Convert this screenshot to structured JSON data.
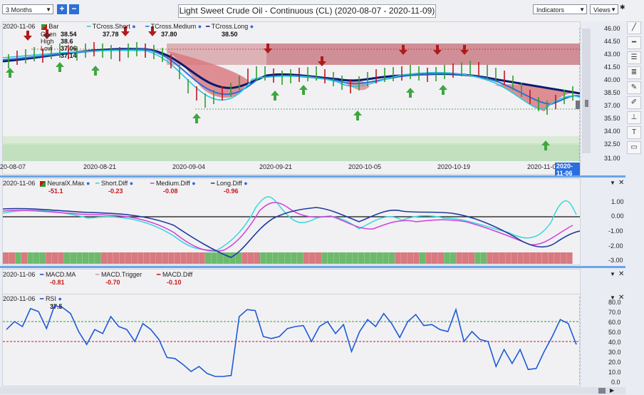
{
  "toolbar": {
    "range_value": "3 Months",
    "add_label": "+",
    "remove_label": "−",
    "title": "Light Sweet Crude Oil - Continuous (CL) (2020-08-07 - 2020-11-09)",
    "indicators_label": "Indicators",
    "views_label": "Views"
  },
  "price_panel": {
    "date": "2020-11-06",
    "bar_label": "Bar",
    "open_label": "Open",
    "open_value": "38.54",
    "high_label": "High",
    "high_value": "38.6",
    "low_label": "Low",
    "low_value": "37.06",
    "close_value": "37.14",
    "tcross_short_label": "TCross.Short",
    "tcross_short_value": "37.78",
    "tcross_medium_label": "TCross.Medium",
    "tcross_medium_value": "37.80",
    "tcross_long_label": "TCross.Long",
    "tcross_long_value": "38.50",
    "y_ticks": [
      "46.00",
      "44.50",
      "43.00",
      "41.50",
      "40.00",
      "38.50",
      "37.00",
      "35.50",
      "34.00",
      "32.50",
      "31.00"
    ],
    "x_ticks": [
      "20-08-07",
      "2020-08-21",
      "2020-09-04",
      "2020-09-21",
      "2020-10-05",
      "2020-10-19",
      "2020-11-0"
    ],
    "current_date_badge": "2020-11-06",
    "colors": {
      "short": "#28c8dc",
      "medium": "#2a6ee0",
      "long": "#0b1a6e",
      "up": "#2e9e2e",
      "down": "#c01818"
    }
  },
  "neural_panel": {
    "date": "2020-11-06",
    "neuralx_label": "NeuralX.Max",
    "neuralx_value": "-51.1",
    "short_diff_label": "Short.Diff",
    "short_diff_value": "-0.23",
    "medium_diff_label": "Medium.Diff",
    "medium_diff_value": "-0.08",
    "long_diff_label": "Long.Diff",
    "long_diff_value": "-0.96",
    "y_ticks": [
      "1.00",
      "0.00",
      "-1.00",
      "-2.00",
      "-3.00"
    ]
  },
  "macd_panel": {
    "date": "2020-11-06",
    "ma_label": "MACD.MA",
    "ma_value": "-0.81",
    "trigger_label": "MACD.Trigger",
    "trigger_value": "-0.70",
    "diff_label": "MACD.Diff",
    "diff_value": "-0.10"
  },
  "rsi_panel": {
    "date": "2020-11-06",
    "label": "RSI",
    "value": "37.5",
    "y_ticks": [
      "80.0",
      "70.0",
      "60.0",
      "50.0",
      "40.0",
      "30.0",
      "20.0",
      "10.0",
      "0.0"
    ],
    "series": [
      52,
      60,
      55,
      73,
      70,
      53,
      76,
      74,
      68,
      50,
      37,
      52,
      48,
      65,
      55,
      52,
      40,
      58,
      52,
      42,
      24,
      23,
      17,
      10,
      15,
      8,
      5,
      5,
      6,
      65,
      72,
      71,
      45,
      43,
      45,
      53,
      55,
      56,
      40,
      55,
      60,
      48,
      57,
      30,
      50,
      62,
      55,
      68,
      58,
      44,
      60,
      67,
      56,
      57,
      52,
      50,
      72,
      40,
      50,
      42,
      40,
      15,
      32,
      18,
      32,
      12,
      13,
      30,
      45,
      62,
      58,
      37
    ],
    "overbought": 60,
    "oversold": 40
  }
}
